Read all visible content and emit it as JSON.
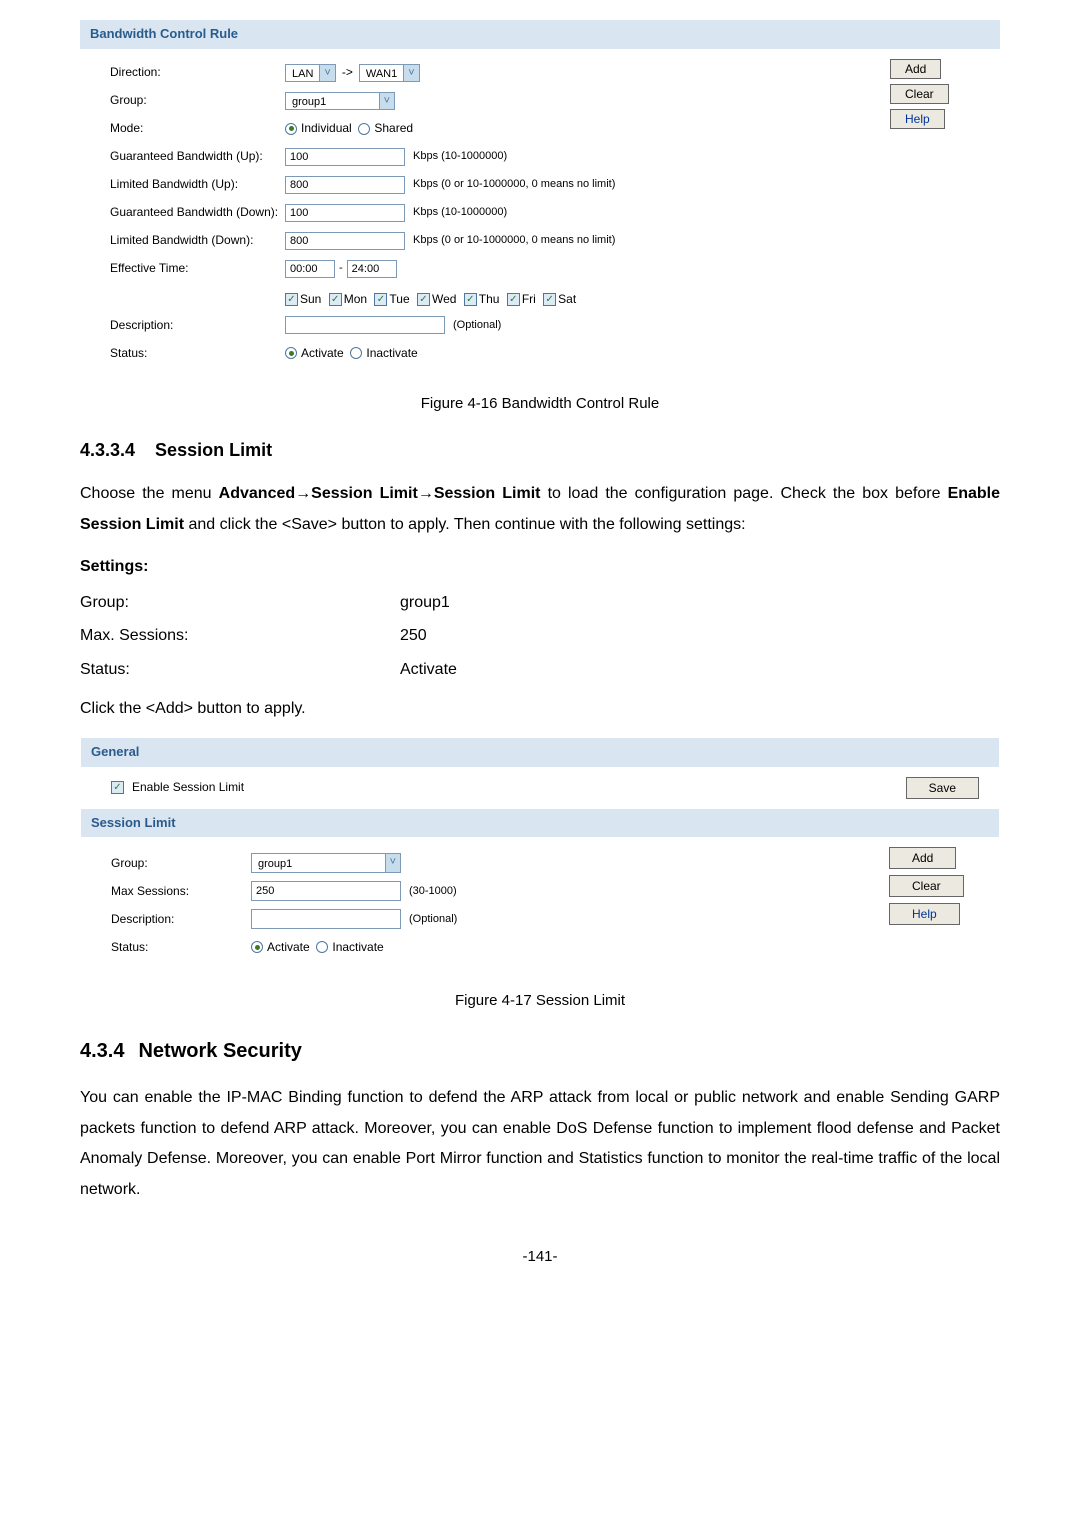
{
  "bw": {
    "header": "Bandwidth Control Rule",
    "labels": {
      "direction": "Direction:",
      "group": "Group:",
      "mode": "Mode:",
      "gbw_up": "Guaranteed Bandwidth (Up):",
      "lbw_up": "Limited Bandwidth (Up):",
      "gbw_down": "Guaranteed Bandwidth (Down):",
      "lbw_down": "Limited Bandwidth (Down):",
      "eff_time": "Effective Time:",
      "description": "Description:",
      "status": "Status:"
    },
    "direction_from": "LAN",
    "direction_arrow": "->",
    "direction_to": "WAN1",
    "group_value": "group1",
    "mode_individual": "Individual",
    "mode_shared": "Shared",
    "gbw_up_value": "100",
    "gbw_up_hint": "Kbps (10-1000000)",
    "lbw_up_value": "800",
    "lbw_up_hint": "Kbps (0 or 10-1000000, 0 means no limit)",
    "gbw_down_value": "100",
    "gbw_down_hint": "Kbps (10-1000000)",
    "lbw_down_value": "800",
    "lbw_down_hint": "Kbps (0 or 10-1000000, 0 means no limit)",
    "time_from": "00:00",
    "time_sep": "-",
    "time_to": "24:00",
    "days": {
      "sun": "Sun",
      "mon": "Mon",
      "tue": "Tue",
      "wed": "Wed",
      "thu": "Thu",
      "fri": "Fri",
      "sat": "Sat"
    },
    "description_placeholder": "(Optional)",
    "status_activate": "Activate",
    "status_inactivate": "Inactivate",
    "buttons": {
      "add": "Add",
      "clear": "Clear",
      "help": "Help"
    }
  },
  "fig1_caption": "Figure 4-16 Bandwidth Control Rule",
  "sec_4_3_3_4": {
    "num": "4.3.3.4",
    "title": "Session Limit"
  },
  "para1_a": "Choose the menu ",
  "para1_b": "Advanced",
  "para1_c": "→",
  "para1_d": "Session Limit",
  "para1_e": "→",
  "para1_f": "Session Limit",
  "para1_g": " to load the configuration page. Check the box before ",
  "para1_h": "Enable Session Limit",
  "para1_i": " and click the <Save> button to apply. Then continue with the following settings:",
  "settings_label": "Settings:",
  "settings": {
    "group_k": "Group:",
    "group_v": "group1",
    "max_k": "Max. Sessions:",
    "max_v": "250",
    "status_k": "Status:",
    "status_v": "Activate"
  },
  "para2": "Click the <Add> button to apply.",
  "sl": {
    "general_header": "General",
    "enable_label": "Enable Session Limit",
    "save_btn": "Save",
    "sl_header": "Session Limit",
    "labels": {
      "group": "Group:",
      "max": "Max Sessions:",
      "description": "Description:",
      "status": "Status:"
    },
    "group_value": "group1",
    "max_value": "250",
    "max_hint": "(30-1000)",
    "description_placeholder": "(Optional)",
    "status_activate": "Activate",
    "status_inactivate": "Inactivate",
    "buttons": {
      "add": "Add",
      "clear": "Clear",
      "help": "Help"
    }
  },
  "fig2_caption": "Figure 4-17 Session Limit",
  "sec_4_3_4": {
    "num": "4.3.4",
    "title": "Network Security"
  },
  "para3": "You can enable the IP-MAC Binding function to defend the ARP attack from local or public network and enable Sending GARP packets function to defend ARP attack. Moreover, you can enable DoS Defense function to implement flood defense and Packet Anomaly Defense. Moreover, you can enable Port Mirror function and Statistics function to monitor the real-time traffic of the local network.",
  "page_num": "-141-"
}
